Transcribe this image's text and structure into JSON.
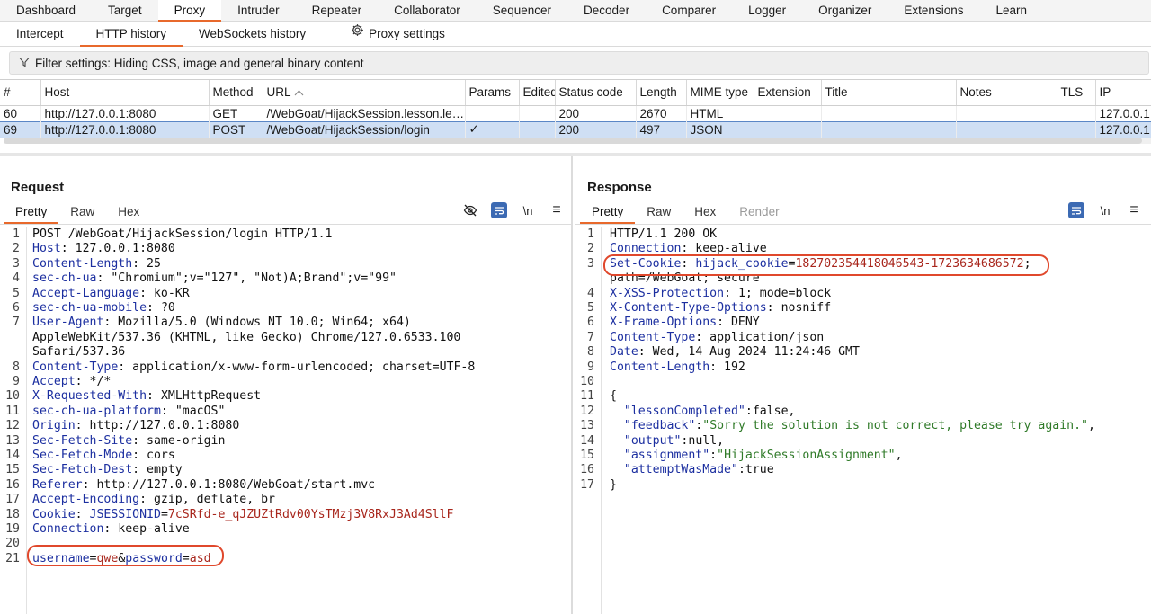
{
  "top_tabs": [
    "Dashboard",
    "Target",
    "Proxy",
    "Intruder",
    "Repeater",
    "Collaborator",
    "Sequencer",
    "Decoder",
    "Comparer",
    "Logger",
    "Organizer",
    "Extensions",
    "Learn"
  ],
  "sub_tabs": [
    "Intercept",
    "HTTP history",
    "WebSockets history",
    "Proxy settings"
  ],
  "filter": "Filter settings: Hiding CSS, image and general binary content",
  "columns": [
    "#",
    "Host",
    "Method",
    "URL",
    "Params",
    "Edited",
    "Status code",
    "Length",
    "MIME type",
    "Extension",
    "Title",
    "Notes",
    "TLS",
    "IP"
  ],
  "rows": [
    {
      "num": "60",
      "host": "http://127.0.0.1:8080",
      "method": "GET",
      "url": "/WebGoat/HijackSession.lesson.les...",
      "params": "",
      "edited": "",
      "status": "200",
      "length": "2670",
      "mime": "HTML",
      "ext": "",
      "title": "",
      "notes": "",
      "tls": "",
      "ip": "127.0.0.1"
    },
    {
      "num": "69",
      "host": "http://127.0.0.1:8080",
      "method": "POST",
      "url": "/WebGoat/HijackSession/login",
      "params": "✓",
      "edited": "",
      "status": "200",
      "length": "497",
      "mime": "JSON",
      "ext": "",
      "title": "",
      "notes": "",
      "tls": "",
      "ip": "127.0.0.1"
    }
  ],
  "request": {
    "title": "Request",
    "tabs": [
      "Pretty",
      "Raw",
      "Hex"
    ],
    "tools": {
      "ln": "\\n",
      "menu": "≡"
    },
    "line_numbers": [
      "1",
      "2",
      "3",
      "4",
      "5",
      "6",
      "7",
      "",
      "",
      "8",
      "9",
      "10",
      "11",
      "12",
      "13",
      "14",
      "15",
      "16",
      "17",
      "18",
      "19",
      "20",
      "21"
    ],
    "lines": [
      {
        "k": "",
        "v": "POST /WebGoat/HijackSession/login HTTP/1.1"
      },
      {
        "k": "Host",
        "v": " 127.0.0.1:8080"
      },
      {
        "k": "Content-Length",
        "v": " 25"
      },
      {
        "k": "sec-ch-ua",
        "v": " \"Chromium\";v=\"127\", \"Not)A;Brand\";v=\"99\""
      },
      {
        "k": "Accept-Language",
        "v": " ko-KR"
      },
      {
        "k": "sec-ch-ua-mobile",
        "v": " ?0"
      },
      {
        "k": "User-Agent",
        "v": " Mozilla/5.0 (Windows NT 10.0; Win64; x64)"
      },
      {
        "k": "",
        "v": "AppleWebKit/537.36 (KHTML, like Gecko) Chrome/127.0.6533.100"
      },
      {
        "k": "",
        "v": "Safari/537.36"
      },
      {
        "k": "Content-Type",
        "v": " application/x-www-form-urlencoded; charset=UTF-8"
      },
      {
        "k": "Accept",
        "v": " */*"
      },
      {
        "k": "X-Requested-With",
        "v": " XMLHttpRequest"
      },
      {
        "k": "sec-ch-ua-platform",
        "v": " \"macOS\""
      },
      {
        "k": "Origin",
        "v": " http://127.0.0.1:8080"
      },
      {
        "k": "Sec-Fetch-Site",
        "v": " same-origin"
      },
      {
        "k": "Sec-Fetch-Mode",
        "v": " cors"
      },
      {
        "k": "Sec-Fetch-Dest",
        "v": " empty"
      },
      {
        "k": "Referer",
        "v": " http://127.0.0.1:8080/WebGoat/start.mvc"
      },
      {
        "k": "Accept-Encoding",
        "v": " gzip, deflate, br"
      },
      {
        "k": "Cookie",
        "v": " ",
        "ck": "JSESSIONID",
        "cv": "7cSRfd-e_qJZUZtRdv00YsTMzj3V8RxJ3Ad4SllF"
      },
      {
        "k": "Connection",
        "v": " keep-alive"
      },
      {
        "k": "",
        "v": ""
      },
      {
        "body": true,
        "k1": "username",
        "v1": "qwe",
        "k2": "password",
        "v2": "asd"
      }
    ]
  },
  "response": {
    "title": "Response",
    "tabs": [
      "Pretty",
      "Raw",
      "Hex",
      "Render"
    ],
    "tools": {
      "ln": "\\n",
      "menu": "≡"
    },
    "line_numbers": [
      "1",
      "2",
      "3",
      "",
      "4",
      "5",
      "6",
      "7",
      "8",
      "9",
      "10",
      "11",
      "12",
      "13",
      "14",
      "15",
      "16",
      "17"
    ],
    "lines": [
      {
        "plain": "HTTP/1.1 200 OK"
      },
      {
        "k": "Connection",
        "v": " keep-alive"
      },
      {
        "k": "Set-Cookie",
        "v": " ",
        "ck": "hijack_cookie",
        "cv": "182702354418046543-1723634686572",
        "tail": ";"
      },
      {
        "plain": "path=/WebGoat; secure"
      },
      {
        "k": "X-XSS-Protection",
        "v": " 1; mode=block"
      },
      {
        "k": "X-Content-Type-Options",
        "v": " nosniff"
      },
      {
        "k": "X-Frame-Options",
        "v": " DENY"
      },
      {
        "k": "Content-Type",
        "v": " application/json"
      },
      {
        "k": "Date",
        "v": " Wed, 14 Aug 2024 11:24:46 GMT"
      },
      {
        "k": "Content-Length",
        "v": " 192"
      },
      {
        "plain": ""
      },
      {
        "plain": "{"
      },
      {
        "jk": "\"lessonCompleted\"",
        "jv": "false",
        "jt": "lit",
        "comma": ","
      },
      {
        "jk": "\"feedback\"",
        "jv": "\"Sorry the solution is not correct, please try again.\"",
        "jt": "str",
        "comma": ","
      },
      {
        "jk": "\"output\"",
        "jv": "null",
        "jt": "lit",
        "comma": ","
      },
      {
        "jk": "\"assignment\"",
        "jv": "\"HijackSessionAssignment\"",
        "jt": "str",
        "comma": ","
      },
      {
        "jk": "\"attemptWasMade\"",
        "jv": "true",
        "jt": "lit",
        "comma": ""
      },
      {
        "plain": "}"
      }
    ]
  },
  "colors": {
    "accent": "#e8692c",
    "key": "#1c2fa0",
    "value": "#a8261c",
    "string": "#2f7a28",
    "highlight": "#e0482c",
    "selection": "#cfdff4"
  }
}
